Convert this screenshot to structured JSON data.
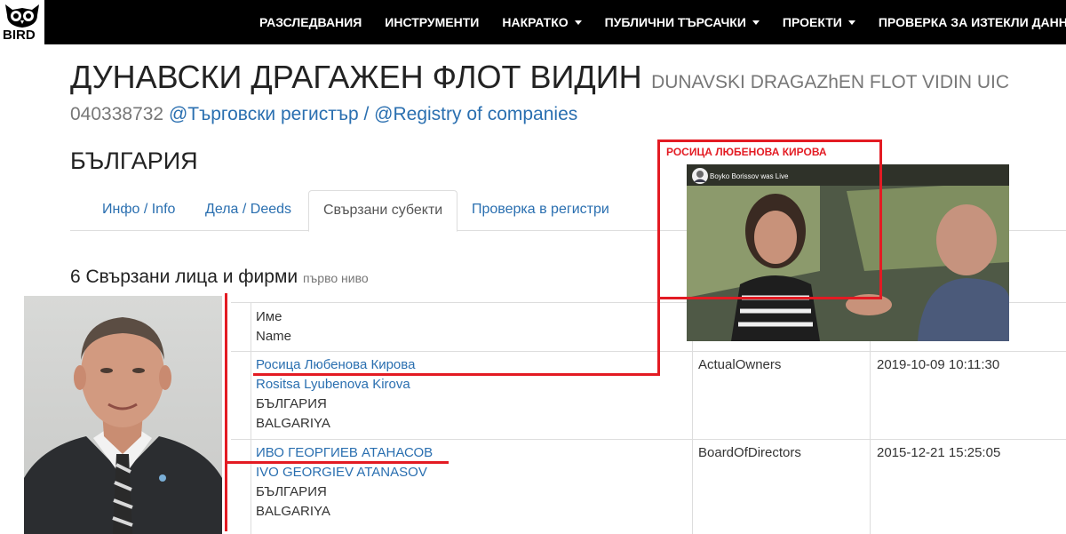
{
  "logo": {
    "text": "BIRD"
  },
  "nav": [
    {
      "label": "РАЗСЛЕДВАНИЯ",
      "dropdown": false
    },
    {
      "label": "ИНСТРУМЕНТИ",
      "dropdown": false
    },
    {
      "label": "НАКРАТКО",
      "dropdown": true
    },
    {
      "label": "ПУБЛИЧНИ ТЪРСАЧКИ",
      "dropdown": true
    },
    {
      "label": "ПРОЕКТИ",
      "dropdown": true
    },
    {
      "label": "ПРОВЕРКА ЗА ИЗТЕКЛИ ДАННИ",
      "dropdown": false
    }
  ],
  "company": {
    "name": "ДУНАВСКИ ДРАГАЖЕН ФЛОТ ВИДИН",
    "name_latin": "DUNAVSKI DRAGAZhEN FLOT VIDIN UIC",
    "uic": "040338732",
    "registry_bg": "@Търговски регистър",
    "separator": "/",
    "registry_en": "@Registry of companies",
    "country": "БЪЛГАРИЯ"
  },
  "tabs": [
    {
      "label": "Инфо / Info",
      "active": false
    },
    {
      "label": "Дела / Deeds",
      "active": false
    },
    {
      "label": "Свързани субекти",
      "active": true
    },
    {
      "label": "Проверка в регистри",
      "active": false
    }
  ],
  "section": {
    "title": "6 Свързани лица и фирми",
    "subtitle": "първо ниво"
  },
  "table": {
    "header": {
      "name_bg": "Име",
      "name_en": "Name"
    },
    "rows": [
      {
        "name": "Росица Любенова Кирова",
        "name_latin": "Rositsa Lyubenova Kirova",
        "country": "БЪЛГАРИЯ",
        "country_latin": "BALGARIYA",
        "role": "ActualOwners",
        "date": "2019-10-09 10:11:30"
      },
      {
        "name": "ИВО ГЕОРГИЕВ АТАНАСОВ",
        "name_latin": "IVO GEORGIEV ATANASOV",
        "country": "БЪЛГАРИЯ",
        "country_latin": "BALGARIYA",
        "role": "BoardOfDirectors",
        "date": "2015-12-21 15:25:05"
      }
    ]
  },
  "annotation": {
    "label": "РОСИЦА ЛЮБЕНОВА КИРОВА",
    "video_caption": "Boyko Borissov was Live"
  },
  "colors": {
    "navbar": "#000000",
    "link": "#2a6fb0",
    "annotation": "#e31b23"
  }
}
